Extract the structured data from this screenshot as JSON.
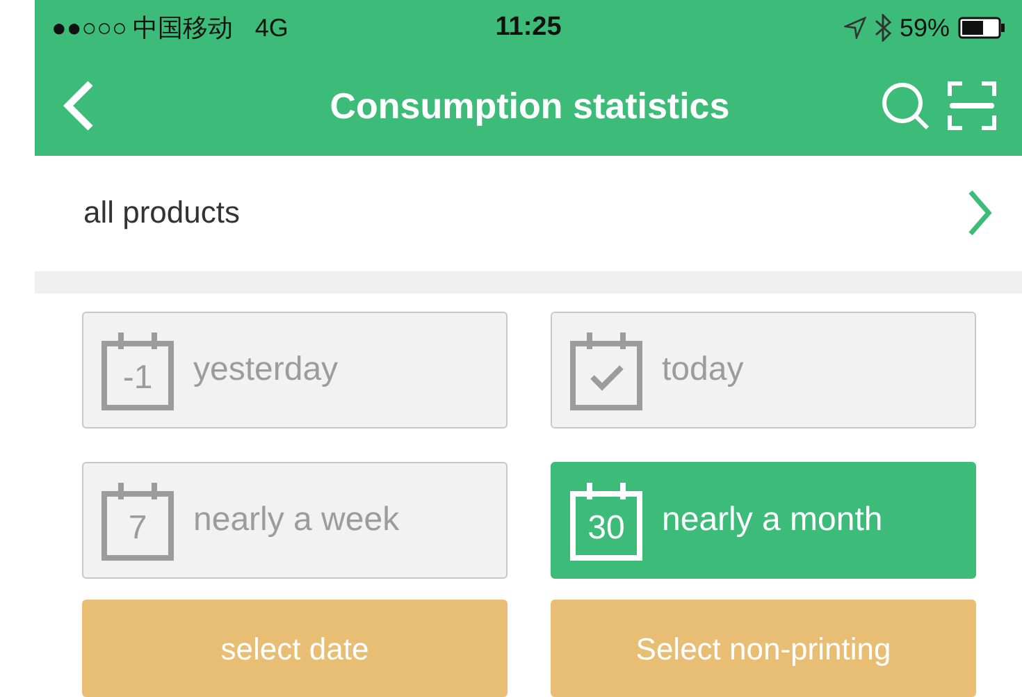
{
  "status_bar": {
    "signal": "●●○○○",
    "carrier": "中国移动",
    "network": "4G",
    "time": "11:25",
    "battery": "59%"
  },
  "nav": {
    "title": "Consumption statistics"
  },
  "product_row": {
    "label": "all products"
  },
  "periods": [
    {
      "label": "yesterday",
      "kind": "text",
      "icon_text": "-1",
      "selected": false
    },
    {
      "label": "today",
      "kind": "check",
      "selected": false
    },
    {
      "label": "nearly a week",
      "kind": "text",
      "icon_text": "7",
      "selected": false
    },
    {
      "label": "nearly a month",
      "kind": "text",
      "icon_text": "30",
      "selected": true
    }
  ],
  "actions": [
    "select date",
    "Select non-printing"
  ]
}
